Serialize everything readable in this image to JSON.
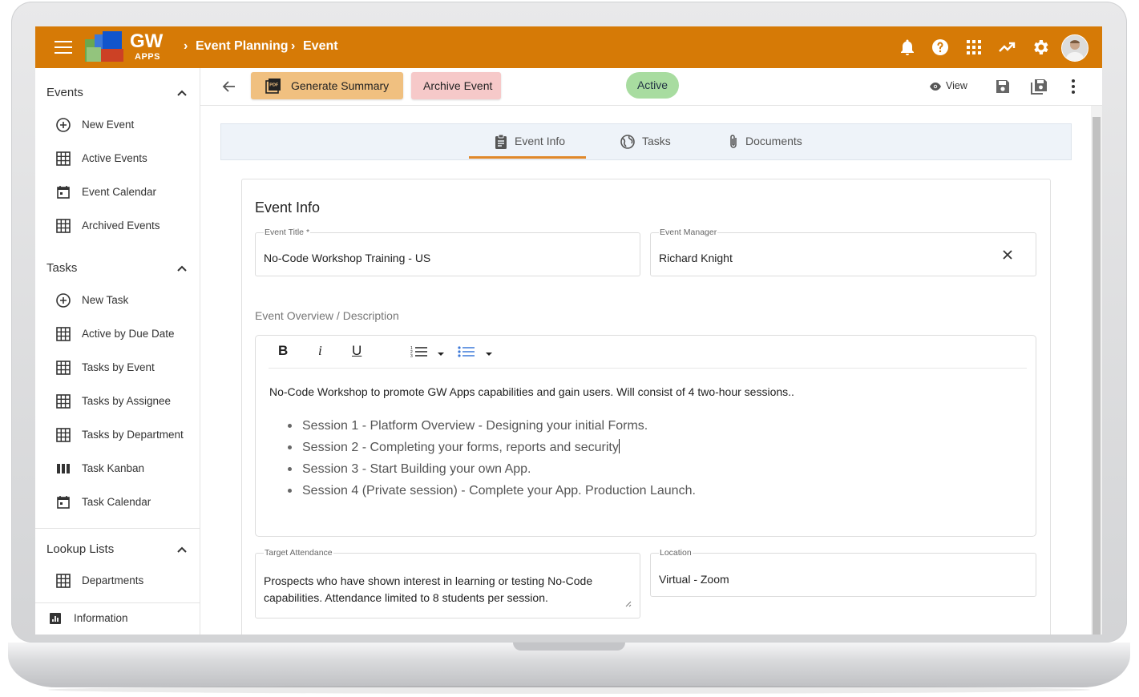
{
  "topbar": {
    "logo_text": "GW",
    "logo_sub": "APPS",
    "breadcrumbs": [
      "Event Planning",
      "Event"
    ],
    "bar_color": "#d67a06",
    "icons": [
      "bell-icon",
      "help-icon",
      "apps-grid-icon",
      "trending-up-icon",
      "gear-icon",
      "avatar"
    ]
  },
  "sidebar": {
    "sections": [
      {
        "title": "Events",
        "items": [
          {
            "label": "New Event",
            "icon": "add-circle-icon"
          },
          {
            "label": "Active Events",
            "icon": "grid-icon"
          },
          {
            "label": "Event Calendar",
            "icon": "calendar-icon"
          },
          {
            "label": "Archived Events",
            "icon": "grid-icon"
          }
        ]
      },
      {
        "title": "Tasks",
        "items": [
          {
            "label": "New Task",
            "icon": "add-circle-icon"
          },
          {
            "label": "Active by Due Date",
            "icon": "grid-icon"
          },
          {
            "label": "Tasks by Event",
            "icon": "grid-icon"
          },
          {
            "label": "Tasks by Assignee",
            "icon": "grid-icon"
          },
          {
            "label": "Tasks by Department",
            "icon": "grid-icon"
          },
          {
            "label": "Task Kanban",
            "icon": "kanban-icon"
          },
          {
            "label": "Task Calendar",
            "icon": "calendar-icon"
          }
        ]
      },
      {
        "title": "Lookup Lists",
        "items": [
          {
            "label": "Departments",
            "icon": "grid-icon"
          }
        ]
      }
    ],
    "footer_item": {
      "label": "Information",
      "icon": "bar-chart-icon"
    }
  },
  "toolbar": {
    "generate_label": "Generate Summary",
    "archive_label": "Archive Event",
    "status_label": "Active",
    "view_label": "View",
    "generate_color": "#f0c080",
    "archive_color": "#f6c9c9",
    "status_color": "#a8dca0"
  },
  "tabs": [
    {
      "label": "Event Info",
      "icon": "clipboard-icon",
      "active": true
    },
    {
      "label": "Tasks",
      "icon": "globe-icon",
      "active": false
    },
    {
      "label": "Documents",
      "icon": "paperclip-icon",
      "active": false
    }
  ],
  "form": {
    "title": "Event Info",
    "event_title": {
      "label": "Event Title *",
      "value": "No-Code Workshop Training - US"
    },
    "event_manager": {
      "label": "Event Manager",
      "value": "Richard Knight"
    },
    "description_label": "Event Overview / Description",
    "description_intro": "No-Code Workshop to promote GW Apps capabilities and gain users. Will consist of 4 two-hour sessions..",
    "description_bullets": [
      "Session 1 - Platform Overview - Designing your initial Forms.",
      "Session 2 - Completing your forms, reports and security",
      "Session 3 - Start Building your own App.",
      "Session 4 (Private session)  - Complete your App. Production Launch."
    ],
    "editor_tools": {
      "bold": "B",
      "italic": "i",
      "underline": "U"
    },
    "target_attendance": {
      "label": "Target Attendance",
      "line1": "Prospects who have shown interest in learning or testing No-Code",
      "line2": "capabilities. Attendance limited to 8 students per session."
    },
    "location": {
      "label": "Location",
      "value": "Virtual - Zoom"
    }
  }
}
